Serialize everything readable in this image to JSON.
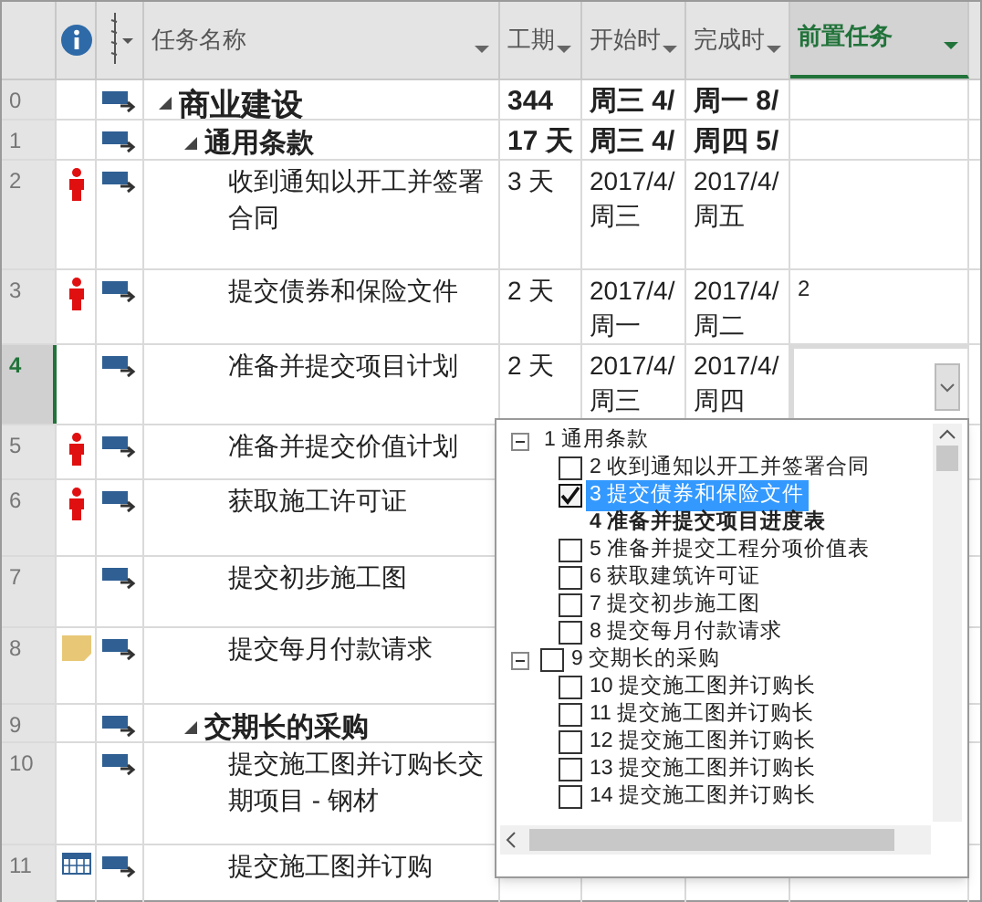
{
  "columns": [
    {
      "label": "任务名称",
      "selected": false
    },
    {
      "label": "工期",
      "selected": false
    },
    {
      "label": "开始时",
      "selected": false
    },
    {
      "label": "完成时",
      "selected": false
    },
    {
      "label": "前置任务",
      "selected": true
    }
  ],
  "rows": [
    {
      "id": "0",
      "name": "商业建设",
      "duration": "344",
      "start": "周三 4/",
      "finish": "周一 8/",
      "selected": false,
      "children": [
        {
          "id": "1",
          "name": "通用条款",
          "duration": "17 天",
          "start": "周三 4/",
          "finish": "周四 5/",
          "selected": false,
          "children": [
            {
              "id": "2",
              "kind": "person",
              "name": "收到通知以开工并签署合同",
              "duration": "3 天",
              "start": "2017/4/\n周三",
              "finish": "2017/4/\n周五",
              "selected": false
            },
            {
              "id": "3",
              "kind": "person",
              "name": "提交债券和保险文件",
              "duration": "2 天",
              "start": "2017/4/\n周一",
              "finish": "2017/4/\n周二",
              "predecessors": "2",
              "selected": false
            },
            {
              "id": "4",
              "name": "准备并提交项目计划",
              "duration": "2 天",
              "start": "2017/4/\n周三",
              "finish": "2017/4/\n周四",
              "selected": true
            },
            {
              "id": "5",
              "kind": "person",
              "name": "准备并提交价值计划",
              "selected": false
            },
            {
              "id": "6",
              "kind": "person",
              "name": "获取施工许可证",
              "selected": false
            },
            {
              "id": "7",
              "name": "提交初步施工图",
              "selected": false
            },
            {
              "id": "8",
              "kind": "note",
              "name": "提交每月付款请求",
              "selected": false
            }
          ]
        },
        {
          "id": "9",
          "name": "交期长的采购",
          "selected": false,
          "children": [
            {
              "id": "10",
              "name": "提交施工图并订购长交期项目 - 钢材",
              "selected": false
            },
            {
              "id": "11",
              "kind": "calendar",
              "name": "提交施工图并订购",
              "selected": false
            }
          ]
        }
      ]
    }
  ],
  "dropdown": {
    "items": [
      {
        "label": "1  通用条款",
        "kind": "group",
        "selected": false,
        "children": [
          {
            "label": "2  收到通知以开工并签署合同",
            "kind": "task",
            "checked": false,
            "selected": false
          },
          {
            "label": "3  提交债券和保险文件",
            "kind": "task",
            "checked": true,
            "selected": true
          },
          {
            "label": "4  准备并提交项目进度表",
            "kind": "current",
            "selected": false
          },
          {
            "label": "5  准备并提交工程分项价值表",
            "kind": "task",
            "checked": false,
            "selected": false
          },
          {
            "label": "6  获取建筑许可证",
            "kind": "task",
            "checked": false,
            "selected": false
          },
          {
            "label": "7  提交初步施工图",
            "kind": "task",
            "checked": false,
            "selected": false
          },
          {
            "label": "8  提交每月付款请求",
            "kind": "task",
            "checked": false,
            "selected": false
          }
        ]
      },
      {
        "label": "9  交期长的采购",
        "kind": "task",
        "checked": false,
        "selected": false,
        "children": [
          {
            "label": "10  提交施工图并订购长",
            "kind": "task",
            "checked": false,
            "selected": false
          },
          {
            "label": "11  提交施工图并订购长",
            "kind": "task",
            "checked": false,
            "selected": false
          },
          {
            "label": "12  提交施工图并订购长",
            "kind": "task",
            "checked": false,
            "selected": false
          },
          {
            "label": "13  提交施工图并订购长",
            "kind": "task",
            "checked": false,
            "selected": false
          },
          {
            "label": "14  提交施工图并订购长",
            "kind": "task",
            "checked": false,
            "selected": false
          }
        ]
      }
    ]
  }
}
